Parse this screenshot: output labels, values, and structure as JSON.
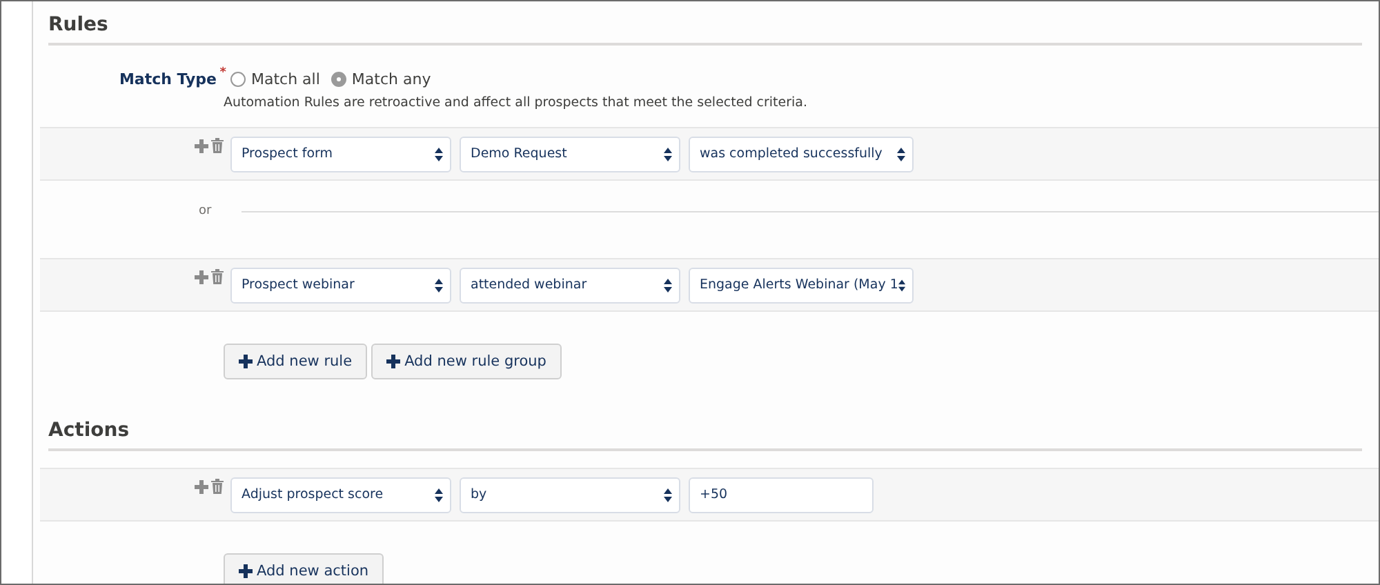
{
  "rules": {
    "heading": "Rules",
    "match_type": {
      "label": "Match Type",
      "required_mark": "*",
      "options": [
        {
          "label": "Match all",
          "selected": false
        },
        {
          "label": "Match any",
          "selected": true
        }
      ],
      "help": "Automation Rules are retroactive and affect all prospects that meet the selected criteria."
    },
    "rows": [
      {
        "fields": [
          {
            "kind": "select",
            "value": "Prospect form"
          },
          {
            "kind": "select",
            "value": "Demo Request"
          },
          {
            "kind": "select",
            "value": "was completed successfully"
          }
        ]
      },
      {
        "separator": "or"
      },
      {
        "fields": [
          {
            "kind": "select",
            "value": "Prospect webinar"
          },
          {
            "kind": "select",
            "value": "attended webinar"
          },
          {
            "kind": "select",
            "value": "Engage Alerts Webinar (May 1"
          }
        ]
      }
    ],
    "buttons": [
      "Add new rule",
      "Add new rule group"
    ]
  },
  "actions": {
    "heading": "Actions",
    "rows": [
      {
        "fields": [
          {
            "kind": "select",
            "value": "Adjust prospect score"
          },
          {
            "kind": "select",
            "value": "by"
          },
          {
            "kind": "input",
            "value": "+50"
          }
        ]
      }
    ],
    "buttons": [
      "Add new action"
    ]
  }
}
